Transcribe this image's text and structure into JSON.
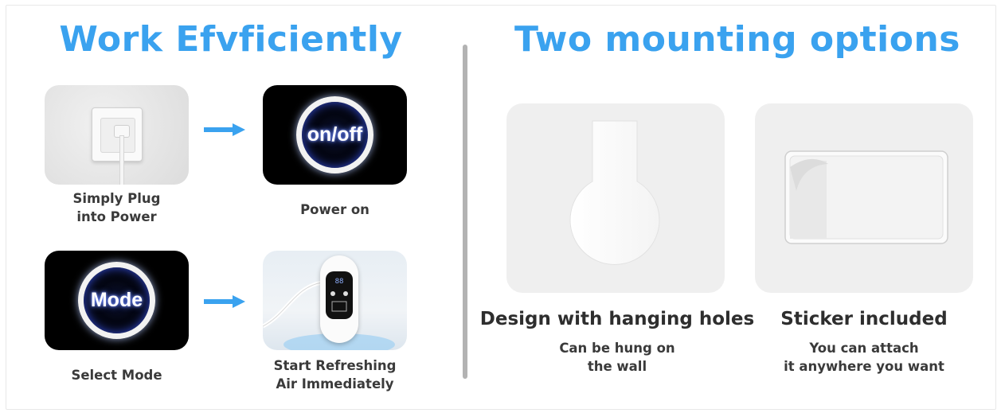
{
  "left_section": {
    "title": "Work Efvficiently",
    "steps": [
      {
        "caption": "Simply Plug\ninto Power"
      },
      {
        "caption": "Power on",
        "badge": "on/off"
      },
      {
        "caption": "Select Mode",
        "badge": "Mode"
      },
      {
        "caption": "Start Refreshing\nAir Immediately"
      }
    ]
  },
  "right_section": {
    "title": "Two mounting options",
    "options": [
      {
        "heading": "Design with hanging holes",
        "sub": "Can be hung on\nthe wall"
      },
      {
        "heading": "Sticker included",
        "sub": "You can attach\nit anywhere you want"
      }
    ]
  },
  "colors": {
    "accent": "#3aa2ef",
    "arrow": "#3aa2ef",
    "divider": "#b3b3b3",
    "caption": "#3a3a3a"
  }
}
